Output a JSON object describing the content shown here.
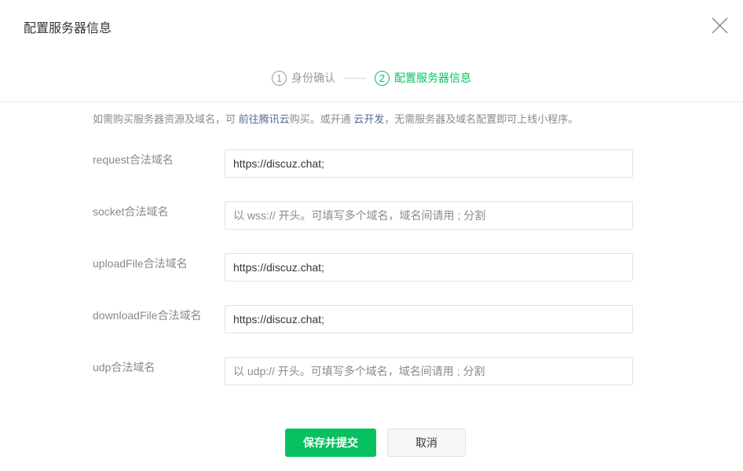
{
  "dialog": {
    "title": "配置服务器信息"
  },
  "steps": [
    {
      "number": "1",
      "label": "身份确认",
      "active": false
    },
    {
      "number": "2",
      "label": "配置服务器信息",
      "active": true
    }
  ],
  "tip": {
    "prefix": "如需购买服务器资源及域名，可 ",
    "link1": "前往腾讯云",
    "middle": "购买。或开通 ",
    "link2": "云开发",
    "suffix": "，无需服务器及域名配置即可上线小程序。"
  },
  "fields": [
    {
      "label": "request合法域名",
      "value": "https://discuz.chat;",
      "placeholder": ""
    },
    {
      "label": "socket合法域名",
      "value": "",
      "placeholder": "以 wss:// 开头。可填写多个域名，域名间请用 ; 分割"
    },
    {
      "label": "uploadFile合法域名",
      "value": "https://discuz.chat;",
      "placeholder": ""
    },
    {
      "label": "downloadFile合法域名",
      "value": "https://discuz.chat;",
      "placeholder": ""
    },
    {
      "label": "udp合法域名",
      "value": "",
      "placeholder": "以 udp:// 开头。可填写多个域名，域名间请用 ; 分割"
    }
  ],
  "buttons": {
    "submit": "保存并提交",
    "cancel": "取消"
  },
  "colors": {
    "accent": "#07c160",
    "link": "#576b95",
    "muted": "#8a8a8a"
  }
}
